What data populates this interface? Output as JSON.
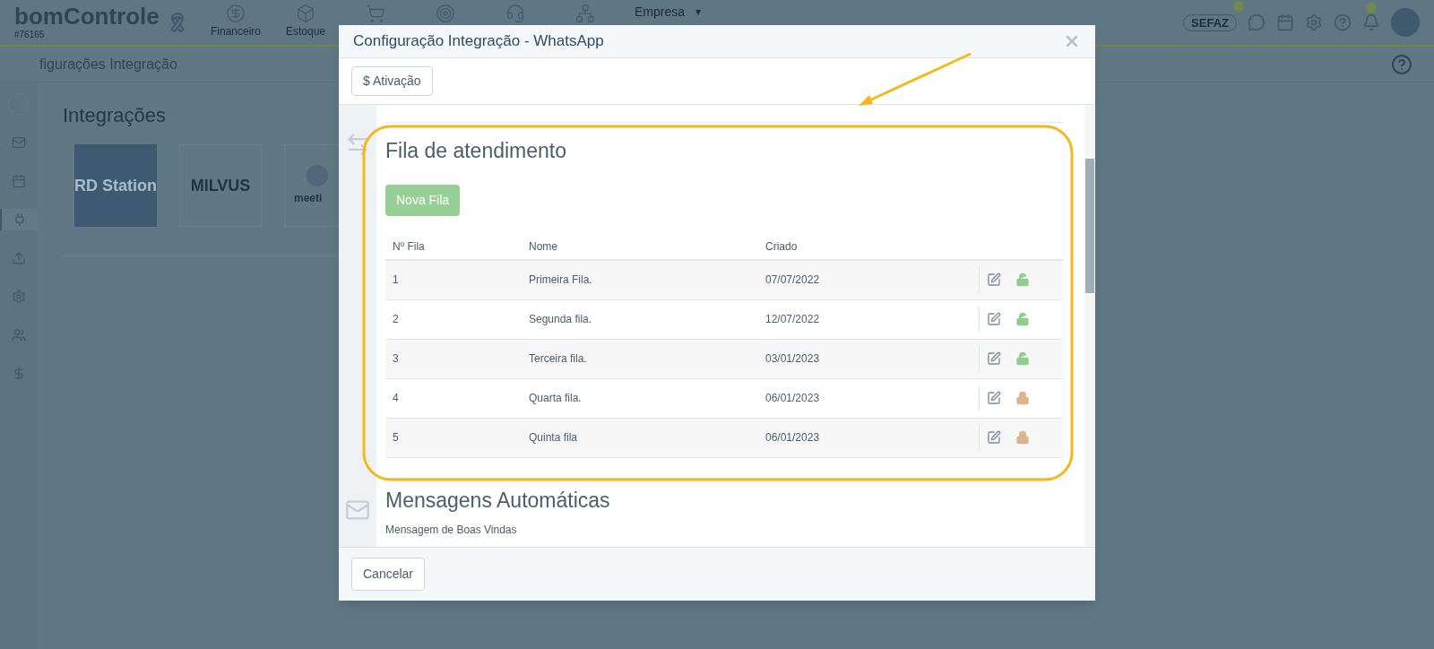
{
  "app_header": {
    "logo": "bomControle",
    "account": "#76165",
    "nav": [
      {
        "label": "Financeiro"
      },
      {
        "label": "Estoque"
      }
    ],
    "company": "Empresa",
    "caret": "▾",
    "sefaz": "SEFAZ"
  },
  "sidebar": [
    {
      "selected": false
    },
    {
      "selected": false
    },
    {
      "selected": true
    },
    {
      "selected": false
    },
    {
      "selected": false
    },
    {
      "selected": false
    },
    {
      "selected": false
    }
  ],
  "page": {
    "title": "figurações Integração",
    "heading": "Integrações",
    "integrations": [
      {
        "name": "RD Station",
        "kind": "filled"
      },
      {
        "name": "MILVUS",
        "kind": "outline"
      },
      {
        "name": "meeti",
        "kind": "outline"
      }
    ]
  },
  "modal": {
    "title": "Configuração Integração - WhatsApp",
    "toolbar_button": "$ Ativação",
    "queue_section": {
      "heading": "Fila de atendimento",
      "new_button": "Nova Fila",
      "columns": [
        "Nº Fila",
        "Nome",
        "Criado"
      ],
      "rows": [
        {
          "number": "1",
          "name": "Primeira Fila.",
          "created": "07/07/2022",
          "locked": false
        },
        {
          "number": "2",
          "name": "Segunda fila.",
          "created": "12/07/2022",
          "locked": false
        },
        {
          "number": "3",
          "name": "Terceira fila.",
          "created": "03/01/2023",
          "locked": false
        },
        {
          "number": "4",
          "name": "Quarta fila.",
          "created": "06/01/2023",
          "locked": true
        },
        {
          "number": "5",
          "name": "Quinta fila",
          "created": "06/01/2023",
          "locked": true
        }
      ]
    },
    "messages_section": {
      "heading": "Mensagens Automáticas",
      "label": "Mensagem de Boas Vindas"
    },
    "cancel_button": "Cancelar"
  }
}
